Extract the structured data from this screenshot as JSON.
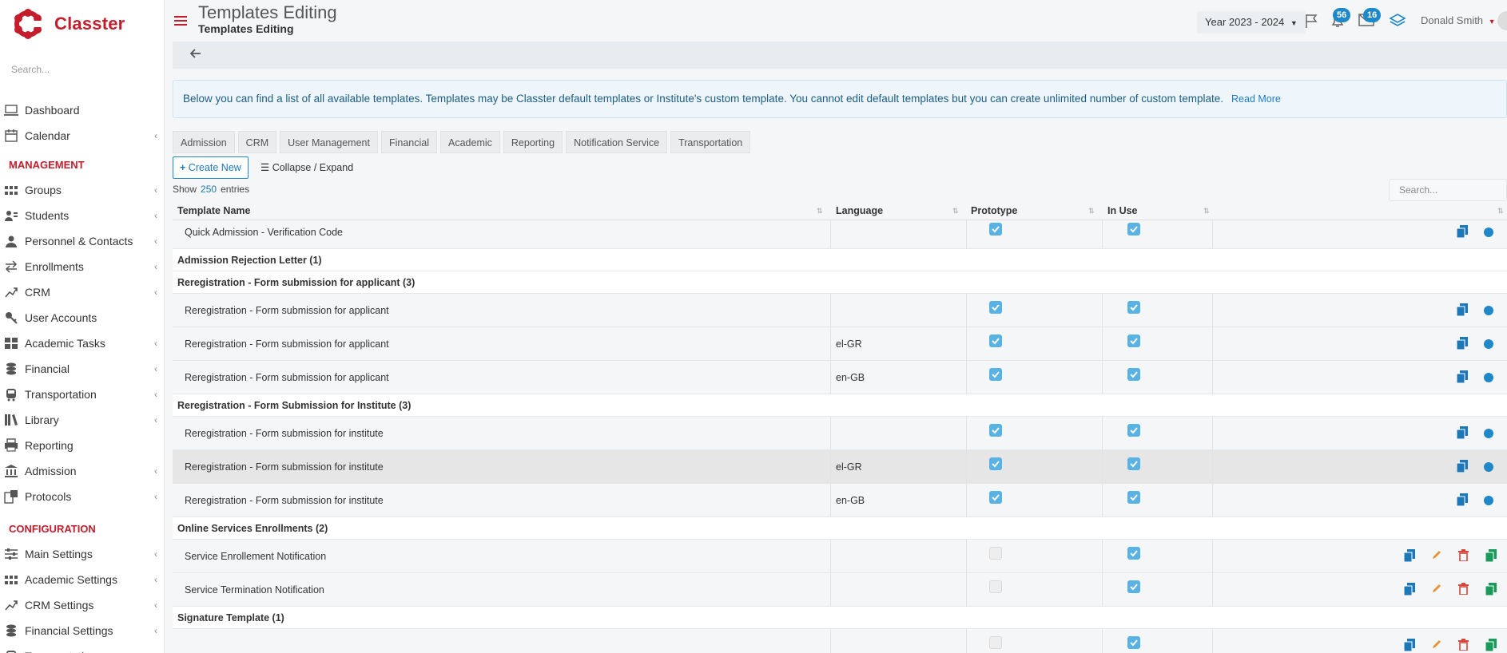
{
  "app": {
    "name": "Classter",
    "brand_color": "#c41d2c",
    "accent_color": "#1e88c8"
  },
  "sidebar": {
    "search_placeholder": "Search...",
    "top_items": [
      {
        "label": "Dashboard",
        "icon": "laptop-icon"
      },
      {
        "label": "Calendar",
        "icon": "calendar-icon"
      }
    ],
    "management_title": "MANAGEMENT",
    "management_items": [
      {
        "label": "Groups",
        "icon": "groups-icon"
      },
      {
        "label": "Students",
        "icon": "students-icon"
      },
      {
        "label": "Personnel & Contacts",
        "icon": "contacts-icon"
      },
      {
        "label": "Enrollments",
        "icon": "enrollments-icon"
      },
      {
        "label": "CRM",
        "icon": "crm-icon"
      },
      {
        "label": "User Accounts",
        "icon": "key-icon"
      },
      {
        "label": "Academic Tasks",
        "icon": "grid-icon"
      },
      {
        "label": "Financial",
        "icon": "coins-icon"
      },
      {
        "label": "Transportation",
        "icon": "bus-icon"
      },
      {
        "label": "Library",
        "icon": "books-icon"
      },
      {
        "label": "Reporting",
        "icon": "printer-icon"
      },
      {
        "label": "Admission",
        "icon": "institution-icon"
      },
      {
        "label": "Protocols",
        "icon": "protocols-icon"
      }
    ],
    "configuration_title": "CONFIGURATION",
    "configuration_items": [
      {
        "label": "Main Settings",
        "icon": "sliders-icon"
      },
      {
        "label": "Academic Settings",
        "icon": "groups-icon"
      },
      {
        "label": "CRM Settings",
        "icon": "crm-icon"
      },
      {
        "label": "Financial Settings",
        "icon": "coins-icon"
      },
      {
        "label": "Transportation",
        "icon": "bus-icon"
      }
    ]
  },
  "header": {
    "title": "Templates Editing",
    "subtitle": "Templates Editing",
    "year": "Year 2023 - 2024",
    "notifications_count": "56",
    "messages_count": "16",
    "user_name": "Donald Smith"
  },
  "info": {
    "text": "Below you can find a list of all available templates. Templates may be Classter default templates or Institute's custom template. You cannot edit default templates but you can create unlimited number of custom template.",
    "read_more": "Read More"
  },
  "tabs": [
    "Admission",
    "CRM",
    "User Management",
    "Financial",
    "Academic",
    "Reporting",
    "Notification Service",
    "Transportation"
  ],
  "toolbar": {
    "create_label": "Create New",
    "collapse_label": "Collapse / Expand",
    "show_label": "Show",
    "entries_count": "250",
    "entries_label": "entries",
    "search_placeholder": "Search..."
  },
  "table": {
    "headers": {
      "name": "Template Name",
      "language": "Language",
      "prototype": "Prototype",
      "in_use": "In Use"
    },
    "rows": [
      {
        "type": "item",
        "name": "Quick Admission - Verification Code",
        "language": "",
        "prototype": true,
        "in_use": true,
        "actions": "default"
      },
      {
        "type": "group",
        "name": "Admission Rejection Letter (1)"
      },
      {
        "type": "group",
        "name": "Reregistration - Form submission for applicant (3)"
      },
      {
        "type": "item",
        "name": "Reregistration - Form submission for applicant",
        "language": "",
        "prototype": true,
        "in_use": true,
        "actions": "default"
      },
      {
        "type": "item",
        "name": "Reregistration - Form submission for applicant",
        "language": "el-GR",
        "prototype": true,
        "in_use": true,
        "actions": "default"
      },
      {
        "type": "item",
        "name": "Reregistration - Form submission for applicant",
        "language": "en-GB",
        "prototype": true,
        "in_use": true,
        "actions": "default"
      },
      {
        "type": "group",
        "name": "Reregistration - Form Submission for Institute (3)"
      },
      {
        "type": "item",
        "name": "Reregistration - Form submission for institute",
        "language": "",
        "prototype": true,
        "in_use": true,
        "actions": "default"
      },
      {
        "type": "item",
        "name": "Reregistration - Form submission for institute",
        "language": "el-GR",
        "prototype": true,
        "in_use": true,
        "actions": "default",
        "highlight": true
      },
      {
        "type": "item",
        "name": "Reregistration - Form submission for institute",
        "language": "en-GB",
        "prototype": true,
        "in_use": true,
        "actions": "default"
      },
      {
        "type": "group",
        "name": "Online Services Enrollments (2)"
      },
      {
        "type": "item",
        "name": "Service Enrollement Notification",
        "language": "",
        "prototype": false,
        "in_use": true,
        "actions": "custom"
      },
      {
        "type": "item",
        "name": "Service Termination Notification",
        "language": "",
        "prototype": false,
        "in_use": true,
        "actions": "custom"
      },
      {
        "type": "group",
        "name": "Signature Template (1)"
      },
      {
        "type": "item",
        "name": "",
        "language": "",
        "prototype": false,
        "in_use": true,
        "actions": "custom"
      }
    ]
  }
}
